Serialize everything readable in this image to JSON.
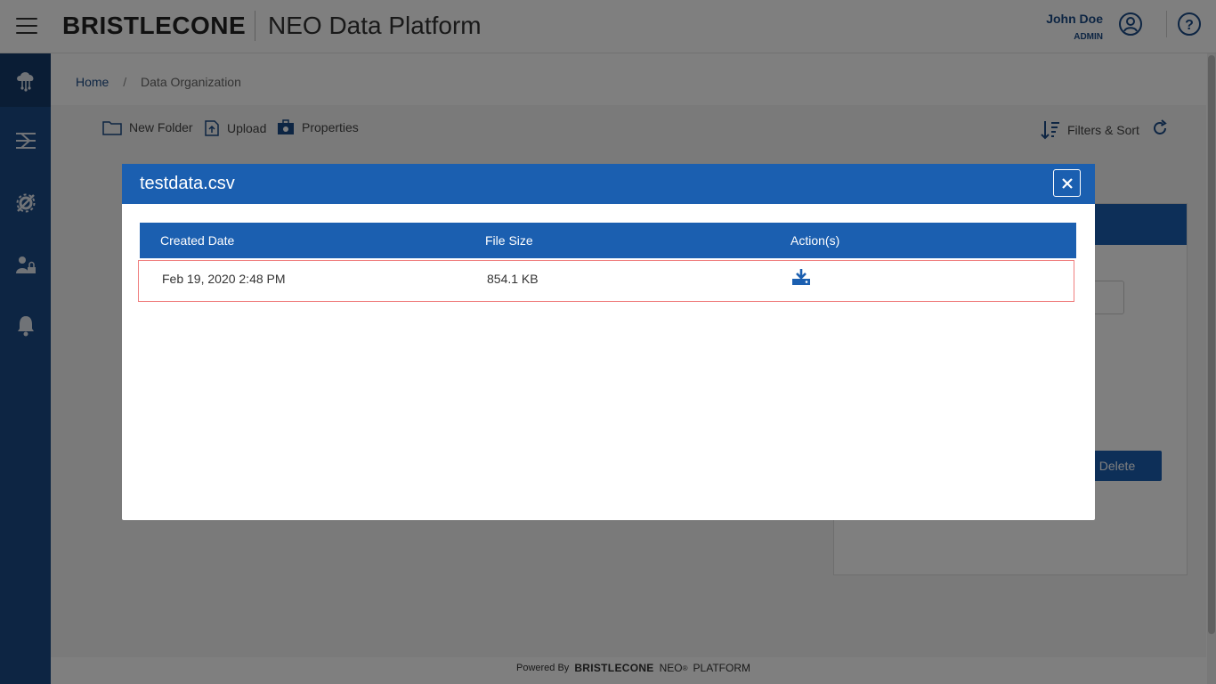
{
  "header": {
    "brand": "BRISTLECONE",
    "app_title": "NEO Data Platform",
    "user_name": "John Doe",
    "user_role": "ADMIN"
  },
  "sidebar": {
    "items": [
      {
        "icon": "cloud-network-icon",
        "active": true
      },
      {
        "icon": "pipeline-icon",
        "active": false
      },
      {
        "icon": "gear-wrench-icon",
        "active": false
      },
      {
        "icon": "user-lock-icon",
        "active": false
      },
      {
        "icon": "bell-icon",
        "active": false
      }
    ]
  },
  "breadcrumb": {
    "home": "Home",
    "separator": "/",
    "current": "Data Organization"
  },
  "toolbar": {
    "new_folder": "New Folder",
    "upload": "Upload",
    "properties": "Properties",
    "filters_sort": "Filters & Sort"
  },
  "panel": {
    "delete_label": "Delete"
  },
  "footer": {
    "powered_by": "Powered By",
    "brand": "BRISTLECONE",
    "neo": "NEO",
    "registered": "®",
    "platform": "PLATFORM"
  },
  "modal": {
    "title": "testdata.csv",
    "columns": [
      "Created Date",
      "File Size",
      "Action(s)"
    ],
    "rows": [
      {
        "created_date": "Feb 19, 2020 2:48 PM",
        "file_size": "854.1 KB",
        "action_icon": "download-icon"
      }
    ]
  },
  "colors": {
    "primary": "#1b5fb0",
    "sidebar": "#1b4a86",
    "row_highlight_border": "#f08080"
  }
}
